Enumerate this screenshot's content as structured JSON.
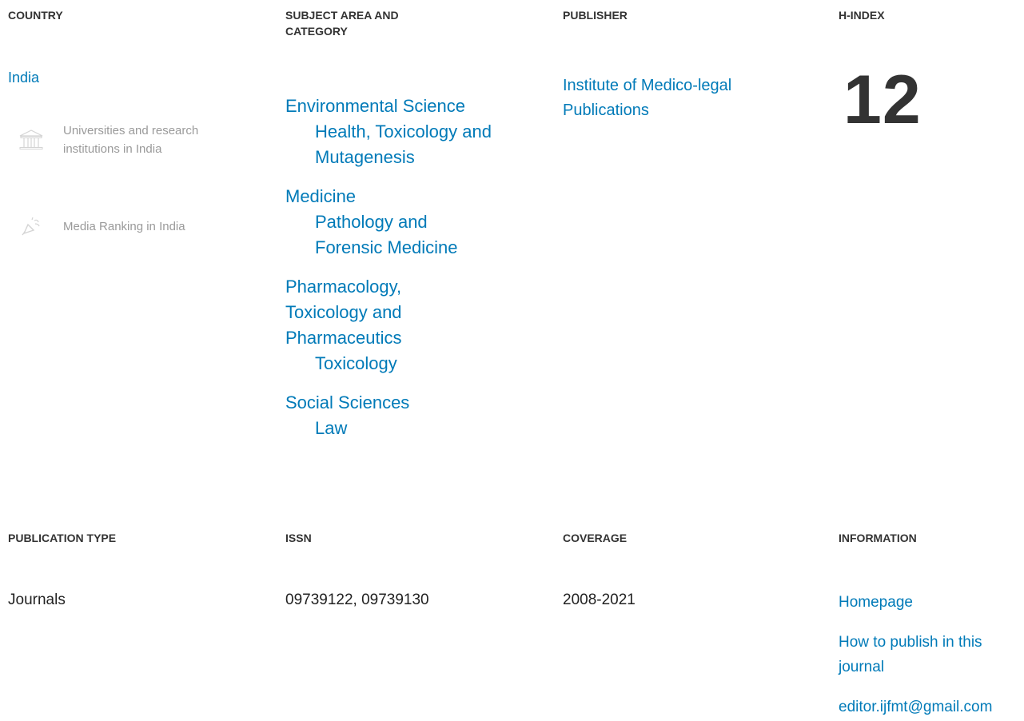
{
  "country": {
    "heading": "COUNTRY",
    "name": "India",
    "links": [
      {
        "label": "Universities and research institutions in India",
        "icon": "institution-icon"
      },
      {
        "label": "Media Ranking in India",
        "icon": "megaphone-icon"
      }
    ]
  },
  "subject_area": {
    "heading": "SUBJECT AREA AND CATEGORY",
    "areas": [
      {
        "name": "Environmental Science",
        "categories": [
          "Health, Toxicology and Mutagenesis"
        ]
      },
      {
        "name": "Medicine",
        "categories": [
          "Pathology and Forensic Medicine"
        ]
      },
      {
        "name": "Pharmacology, Toxicology and Pharmaceutics",
        "categories": [
          "Toxicology"
        ]
      },
      {
        "name": "Social Sciences",
        "categories": [
          "Law"
        ]
      }
    ]
  },
  "publisher": {
    "heading": "PUBLISHER",
    "name": "Institute of Medico-legal Publications"
  },
  "h_index": {
    "heading": "H-INDEX",
    "value": "12"
  },
  "publication_type": {
    "heading": "PUBLICATION TYPE",
    "value": "Journals"
  },
  "issn": {
    "heading": "ISSN",
    "value": "09739122, 09739130"
  },
  "coverage": {
    "heading": "COVERAGE",
    "value": "2008-2021"
  },
  "information": {
    "heading": "INFORMATION",
    "links": [
      "Homepage",
      "How to publish in this journal",
      "editor.ijfmt@gmail.com"
    ]
  },
  "colors": {
    "link": "#007ab8",
    "heading": "#333333",
    "muted": "#9a9a9a"
  }
}
